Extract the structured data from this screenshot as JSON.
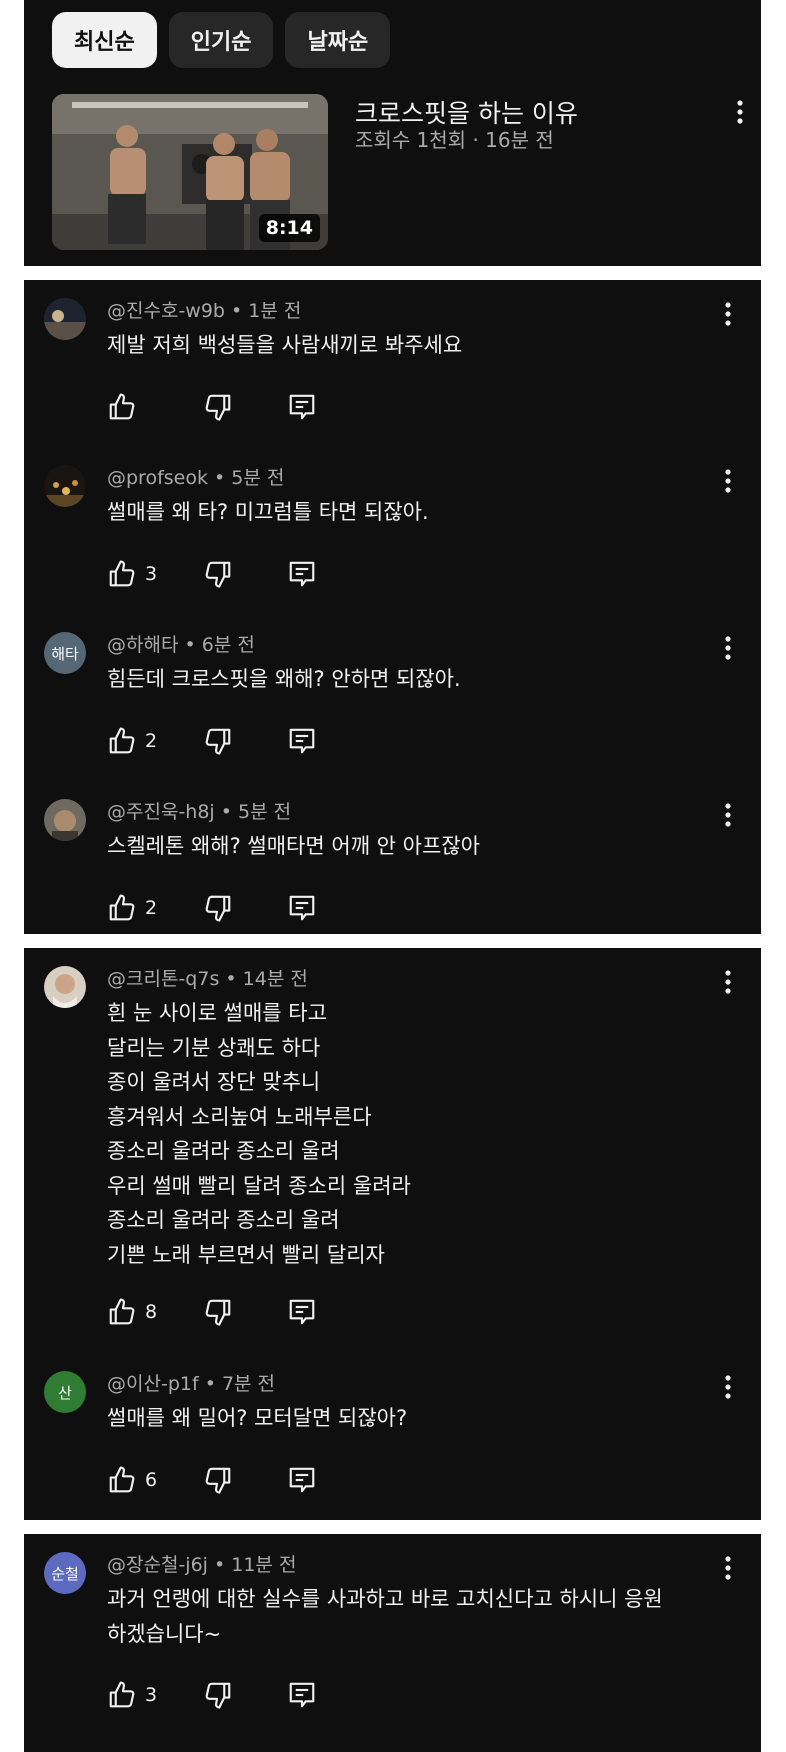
{
  "filters": {
    "latest": "최신순",
    "popular": "인기순",
    "date": "날짜순"
  },
  "video": {
    "title": "크로스핏을 하는 이유",
    "meta": "조회수 1천회 · 16분 전",
    "duration": "8:14"
  },
  "comments": [
    {
      "handle": "@진수호-w9b",
      "time": "1분 전",
      "text": "제발 저희 백성들을 사람새끼로 봐주세요",
      "likes": ""
    },
    {
      "handle": "@profseok",
      "time": "5분 전",
      "text": "썰매를 왜 타? 미끄럼틀 타면 되잖아.",
      "likes": "3"
    },
    {
      "handle": "@하해타",
      "time": "6분 전",
      "avatar_text": "해타",
      "text": "힘든데 크로스핏을 왜해? 안하면 되잖아.",
      "likes": "2"
    },
    {
      "handle": "@주진욱-h8j",
      "time": "5분 전",
      "text": "스켈레톤 왜해? 썰매타면 어깨 안 아프잖아",
      "likes": "2"
    },
    {
      "handle": "@크리톤-q7s",
      "time": "14분 전",
      "text": "흰 눈 사이로 썰매를 타고\n달리는 기분 상쾌도 하다\n종이 울려서 장단 맞추니\n흥겨워서 소리높여 노래부른다\n종소리 울려라 종소리 울려\n우리 썰매 빨리 달려 종소리 울려라\n종소리 울려라 종소리 울려\n기쁜 노래 부르면서 빨리 달리자",
      "likes": "8"
    },
    {
      "handle": "@이산-p1f",
      "time": "7분 전",
      "avatar_text": "산",
      "text": "썰매를 왜 밀어? 모터달면 되잖아?",
      "likes": "6"
    },
    {
      "handle": "@장순철-j6j",
      "time": "11분 전",
      "avatar_text": "순철",
      "text": "과거 언랭에 대한 실수를 사과하고 바로 고치신다고 하시니 응원\n하겠습니다~",
      "likes": "3"
    }
  ],
  "colors": {
    "background": "#0f0f0f",
    "text_primary": "#f1f1f1",
    "text_secondary": "#aaaaaa",
    "avatar_hahaeta": "#556675",
    "avatar_isan": "#2e7d32",
    "avatar_jangsuncheol": "#5c6bc0"
  },
  "icons": [
    "more-vert-icon",
    "thumb-up-icon",
    "thumb-down-icon",
    "reply-icon"
  ]
}
